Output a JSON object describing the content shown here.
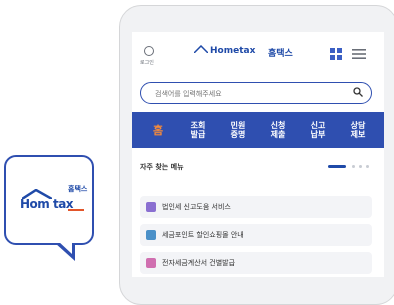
{
  "app_icon": {
    "logo_text": "Hom tax",
    "logo_kr": "홈택스"
  },
  "header": {
    "location_label": "로그인",
    "brand": "Hometax",
    "brand_kr": "홈택스"
  },
  "search": {
    "placeholder": "검색어를 입력해주세요"
  },
  "tabs": [
    {
      "label": "홈"
    },
    {
      "label": "조회 발급"
    },
    {
      "label": "민원 증명"
    },
    {
      "label": "신청 제출"
    },
    {
      "label": "신고 납부"
    },
    {
      "label": "상담 제보"
    }
  ],
  "section": {
    "title": "자주 찾는 메뉴"
  },
  "menu_items": [
    {
      "label": "법인세 신고도움 서비스",
      "icon_color": "#8a6fd1"
    },
    {
      "label": "세금포인트 할인쇼핑몰 안내",
      "icon_color": "#4a90c8"
    },
    {
      "label": "전자세금계산서 건별발급",
      "icon_color": "#d06fb0"
    }
  ],
  "colors": {
    "brand_blue": "#2f4fb0",
    "accent_orange": "#f58a3a"
  }
}
